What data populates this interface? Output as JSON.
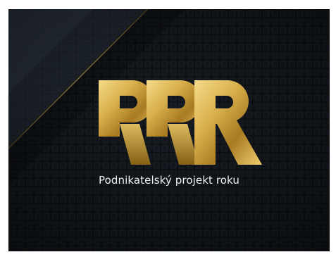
{
  "logo": {
    "letters": "PPR",
    "tagline": "Podnikatelský projekt roku",
    "icon": "ppr-gold-monogram"
  },
  "colors": {
    "background": "#111418",
    "pattern": "#1b2027",
    "diagonal_band": "#2b3642",
    "gold_light": "#f5dc8a",
    "gold_mid": "#c9a13b",
    "gold_dark": "#8a6414",
    "tagline_text": "#eef0f2"
  }
}
